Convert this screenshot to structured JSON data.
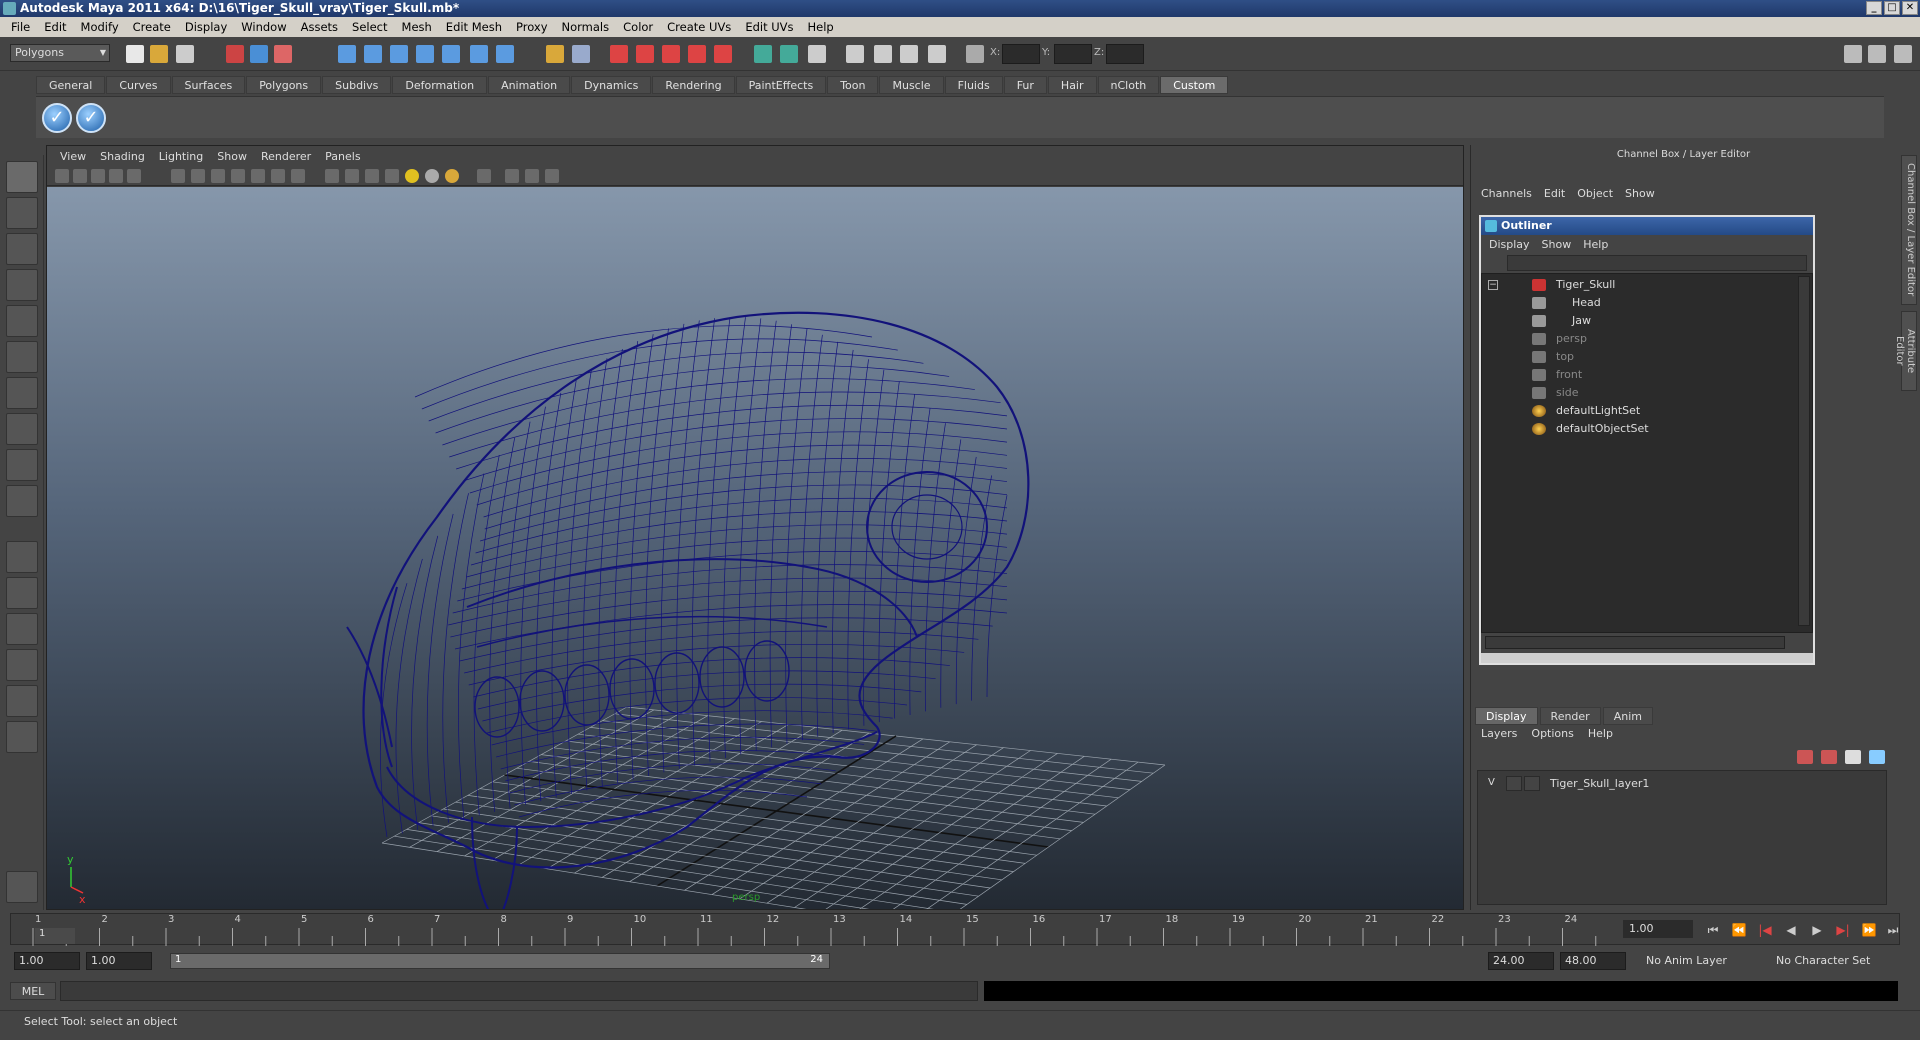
{
  "title": "Autodesk Maya 2011 x64: D:\\16\\Tiger_Skull_vray\\Tiger_Skull.mb*",
  "window_buttons": [
    "_",
    "□",
    "✕"
  ],
  "menubar": [
    "File",
    "Edit",
    "Modify",
    "Create",
    "Display",
    "Window",
    "Assets",
    "Select",
    "Mesh",
    "Edit Mesh",
    "Proxy",
    "Normals",
    "Color",
    "Create UVs",
    "Edit UVs",
    "Help"
  ],
  "mode_selector": "Polygons",
  "coords": {
    "x_label": "X:",
    "y_label": "Y:",
    "z_label": "Z:"
  },
  "shelf_tabs": [
    "General",
    "Curves",
    "Surfaces",
    "Polygons",
    "Subdivs",
    "Deformation",
    "Animation",
    "Dynamics",
    "Rendering",
    "PaintEffects",
    "Toon",
    "Muscle",
    "Fluids",
    "Fur",
    "Hair",
    "nCloth",
    "Custom"
  ],
  "shelf_active": "Custom",
  "viewport": {
    "menu": [
      "View",
      "Shading",
      "Lighting",
      "Show",
      "Renderer",
      "Panels"
    ],
    "axis_x": "x",
    "axis_y": "y",
    "camera_label": "persp"
  },
  "channel_box": {
    "header": "Channel Box / Layer Editor",
    "menu": [
      "Channels",
      "Edit",
      "Object",
      "Show"
    ]
  },
  "outliner": {
    "title": "Outliner",
    "menu": [
      "Display",
      "Show",
      "Help"
    ],
    "items": [
      {
        "name": "Tiger_Skull",
        "level": 0,
        "dim": false
      },
      {
        "name": "Head",
        "level": 1,
        "dim": false
      },
      {
        "name": "Jaw",
        "level": 1,
        "dim": false
      },
      {
        "name": "persp",
        "level": 0,
        "dim": true
      },
      {
        "name": "top",
        "level": 0,
        "dim": true
      },
      {
        "name": "front",
        "level": 0,
        "dim": true
      },
      {
        "name": "side",
        "level": 0,
        "dim": true
      },
      {
        "name": "defaultLightSet",
        "level": 0,
        "dim": false
      },
      {
        "name": "defaultObjectSet",
        "level": 0,
        "dim": false
      }
    ]
  },
  "layer_editor": {
    "tabs": [
      "Display",
      "Render",
      "Anim"
    ],
    "active_tab": "Display",
    "menu": [
      "Layers",
      "Options",
      "Help"
    ],
    "layers": [
      {
        "visible": "V",
        "name": "Tiger_Skull_layer1"
      }
    ]
  },
  "side_tabs": [
    "Channel Box / Layer Editor",
    "Attribute Editor"
  ],
  "timeline": {
    "ticks": [
      1,
      2,
      3,
      4,
      5,
      6,
      7,
      8,
      9,
      10,
      11,
      12,
      13,
      14,
      15,
      16,
      17,
      18,
      19,
      20,
      21,
      22,
      23,
      24
    ],
    "current_frame_marker": "1",
    "current_frame": "1.00"
  },
  "range": {
    "start": "1.00",
    "anim_start": "1.00",
    "slider_start": "1",
    "slider_end": "24",
    "anim_end": "24.00",
    "end": "48.00",
    "anim_layer": "No Anim Layer",
    "character_set": "No Character Set"
  },
  "command_line": {
    "label": "MEL"
  },
  "help_line": "Select Tool: select an object",
  "colors": {
    "wireframe": "#12127a",
    "title_bar": "#2f4f86",
    "outliner_title": "#3d66a9"
  }
}
